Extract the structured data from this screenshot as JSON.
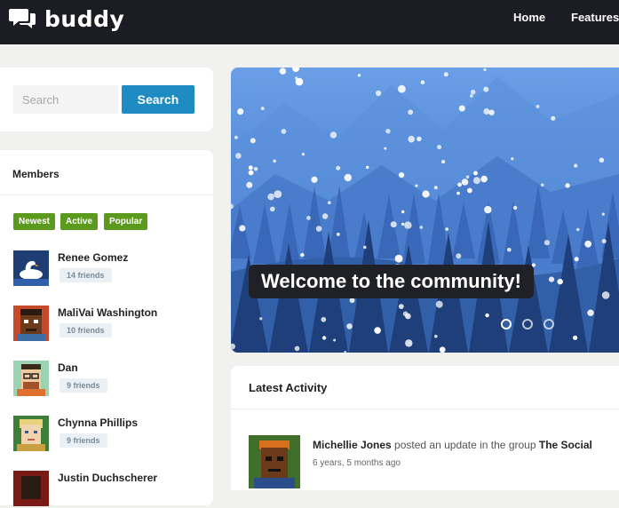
{
  "header": {
    "logo_text": "buddy",
    "nav": [
      {
        "label": "Home"
      },
      {
        "label": "Features"
      }
    ]
  },
  "search": {
    "placeholder": "Search",
    "button_label": "Search"
  },
  "members": {
    "title": "Members",
    "filters": [
      {
        "label": "Newest"
      },
      {
        "label": "Active"
      },
      {
        "label": "Popular"
      }
    ],
    "list": [
      {
        "name": "Renee Gomez",
        "friends": "14 friends"
      },
      {
        "name": "MaliVai Washington",
        "friends": "10 friends"
      },
      {
        "name": "Dan",
        "friends": "9 friends"
      },
      {
        "name": "Chynna Phillips",
        "friends": "9 friends"
      },
      {
        "name": "Justin Duchscherer",
        "friends": ""
      }
    ]
  },
  "hero": {
    "caption": "Welcome to the community!",
    "slides": 3,
    "active_slide": 1
  },
  "activity": {
    "title": "Latest Activity",
    "item": {
      "user": "Michellie Jones",
      "action": "posted an update in the group",
      "group": "The Social",
      "time": "6 years, 5 months ago"
    }
  },
  "colors": {
    "topbar": "#1b1c24",
    "search_button": "#1e8bc3",
    "filter_badge": "#5b9a1c",
    "hero_sky": "#4d86d6"
  }
}
